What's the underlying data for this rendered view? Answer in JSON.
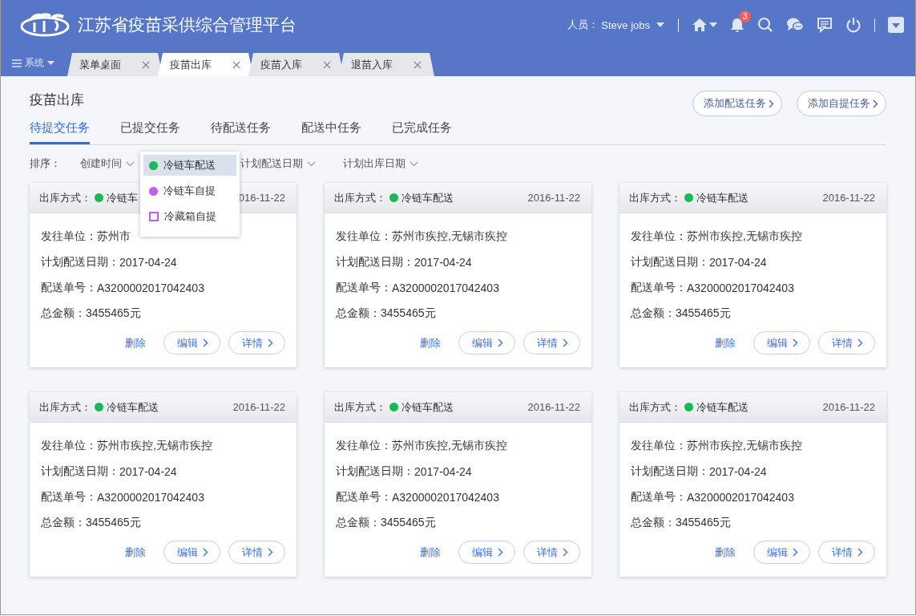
{
  "header": {
    "title": "江苏省疫苗采供综合管理平台",
    "user_label": "人员：",
    "user_name": "Steve jobs",
    "notification_count": "3"
  },
  "nav": {
    "menu_label": "系统",
    "tabs": [
      {
        "label": "菜单桌面",
        "selected": false
      },
      {
        "label": "疫苗出库",
        "selected": true
      },
      {
        "label": "疫苗入库",
        "selected": false
      },
      {
        "label": "退苗入库",
        "selected": false
      }
    ]
  },
  "page": {
    "title": "疫苗出库",
    "actions": [
      "添加配送任务",
      "添加自提任务"
    ],
    "tabs": [
      {
        "label": "待提交任务",
        "selected": true
      },
      {
        "label": "已提交任务",
        "selected": false
      },
      {
        "label": "待配送任务",
        "selected": false
      },
      {
        "label": "配送中任务",
        "selected": false
      },
      {
        "label": "已完成任务",
        "selected": false
      }
    ]
  },
  "sort": {
    "label": "排序：",
    "options": [
      "创建时间",
      "计划配送日期",
      "计划出库日期"
    ]
  },
  "method_menu": {
    "items": [
      {
        "label": "冷链车配送",
        "kind": "dot",
        "color": "#19b955",
        "selected": true
      },
      {
        "label": "冷链车自提",
        "kind": "dot",
        "color": "#c45af0",
        "selected": false
      },
      {
        "label": "冷藏箱自提",
        "kind": "square",
        "color": "#c45af0",
        "selected": false
      }
    ]
  },
  "cards": [
    {
      "method_label": "出库方式：",
      "method": "冷链车",
      "color": "#19b955",
      "date": "016-11-22",
      "fields": [
        {
          "label": "发往单位：",
          "value": "苏州市"
        },
        {
          "label": "计划配送日期：",
          "value": "2017-04-24"
        },
        {
          "label": "配送单号：",
          "value": "A3200002017042403"
        },
        {
          "label": "总金额：",
          "value": "3455465元"
        }
      ],
      "delete": "删除",
      "edit": "编辑",
      "detail": "详情"
    },
    {
      "method_label": "出库方式：",
      "method": "冷链车配送",
      "color": "#19b955",
      "date": "2016-11-22",
      "fields": [
        {
          "label": "发往单位：",
          "value": "苏州市疾控,无锡市疾控"
        },
        {
          "label": "计划配送日期：",
          "value": "2017-04-24"
        },
        {
          "label": "配送单号：",
          "value": "A3200002017042403"
        },
        {
          "label": "总金额：",
          "value": "3455465元"
        }
      ],
      "delete": "删除",
      "edit": "编辑",
      "detail": "详情"
    },
    {
      "method_label": "出库方式：",
      "method": "冷链车配送",
      "color": "#19b955",
      "date": "2016-11-22",
      "fields": [
        {
          "label": "发往单位：",
          "value": "苏州市疾控,无锡市疾控"
        },
        {
          "label": "计划配送日期：",
          "value": "2017-04-24"
        },
        {
          "label": "配送单号：",
          "value": "A3200002017042403"
        },
        {
          "label": "总金额：",
          "value": "3455465元"
        }
      ],
      "delete": "删除",
      "edit": "编辑",
      "detail": "详情"
    },
    {
      "method_label": "出库方式：",
      "method": "冷链车配送",
      "color": "#19b955",
      "date": "2016-11-22",
      "fields": [
        {
          "label": "发往单位：",
          "value": "苏州市疾控,无锡市疾控"
        },
        {
          "label": "计划配送日期：",
          "value": "2017-04-24"
        },
        {
          "label": "配送单号：",
          "value": "A3200002017042403"
        },
        {
          "label": "总金额：",
          "value": "3455465元"
        }
      ],
      "delete": "删除",
      "edit": "编辑",
      "detail": "详情"
    },
    {
      "method_label": "出库方式：",
      "method": "冷链车配送",
      "color": "#19b955",
      "date": "2016-11-22",
      "fields": [
        {
          "label": "发往单位：",
          "value": "苏州市疾控,无锡市疾控"
        },
        {
          "label": "计划配送日期：",
          "value": "2017-04-24"
        },
        {
          "label": "配送单号：",
          "value": "A3200002017042403"
        },
        {
          "label": "总金额：",
          "value": "3455465元"
        }
      ],
      "delete": "删除",
      "edit": "编辑",
      "detail": "详情"
    },
    {
      "method_label": "出库方式：",
      "method": "冷链车配送",
      "color": "#19b955",
      "date": "2016-11-22",
      "fields": [
        {
          "label": "发往单位：",
          "value": "苏州市疾控,无锡市疾控"
        },
        {
          "label": "计划配送日期：",
          "value": "2017-04-24"
        },
        {
          "label": "配送单号：",
          "value": "A3200002017042403"
        },
        {
          "label": "总金额：",
          "value": "3455465元"
        }
      ],
      "delete": "删除",
      "edit": "编辑",
      "detail": "详情"
    }
  ]
}
